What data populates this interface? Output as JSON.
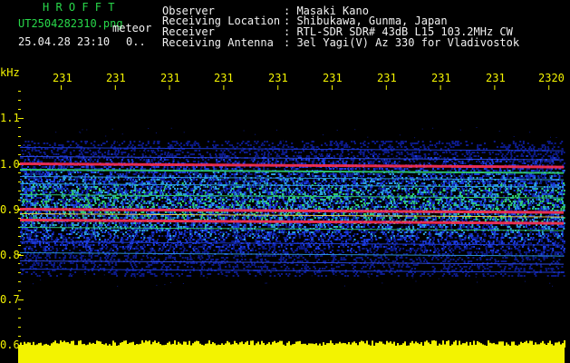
{
  "header": {
    "station": "H R O F F T",
    "filename": "UT2504282310.png",
    "mode": "meteor",
    "datetime": "25.04.28 23:10",
    "extra": "0..",
    "fields": [
      {
        "key": "Observer",
        "value": ": Masaki Kano"
      },
      {
        "key": "Receiving Location",
        "value": ": Shibukawa, Gunma, Japan"
      },
      {
        "key": "Receiver",
        "value": ": RTL-SDR SDR# 43dB L15 103.2MHz CW"
      },
      {
        "key": "Receiving Antenna",
        "value": ": 3el Yagi(V) Az 330 for Vladivostok"
      }
    ]
  },
  "axes": {
    "unit": "kHz",
    "time_ticks": [
      "231",
      "231",
      "231",
      "231",
      "231",
      "231",
      "231",
      "231",
      "231",
      "2320"
    ],
    "freq_ticks": [
      "1.1",
      "1.0",
      "0.9",
      "0.8",
      "0.7",
      "0.6"
    ]
  },
  "colors": {
    "text_green": "#28d84a",
    "text_white": "#f2f2f2",
    "text_yellow": "#f3f300",
    "spectrum_blue": "#1c2cc8",
    "spectrum_red": "#ff3050",
    "band_yellow": "#f3f300"
  }
}
